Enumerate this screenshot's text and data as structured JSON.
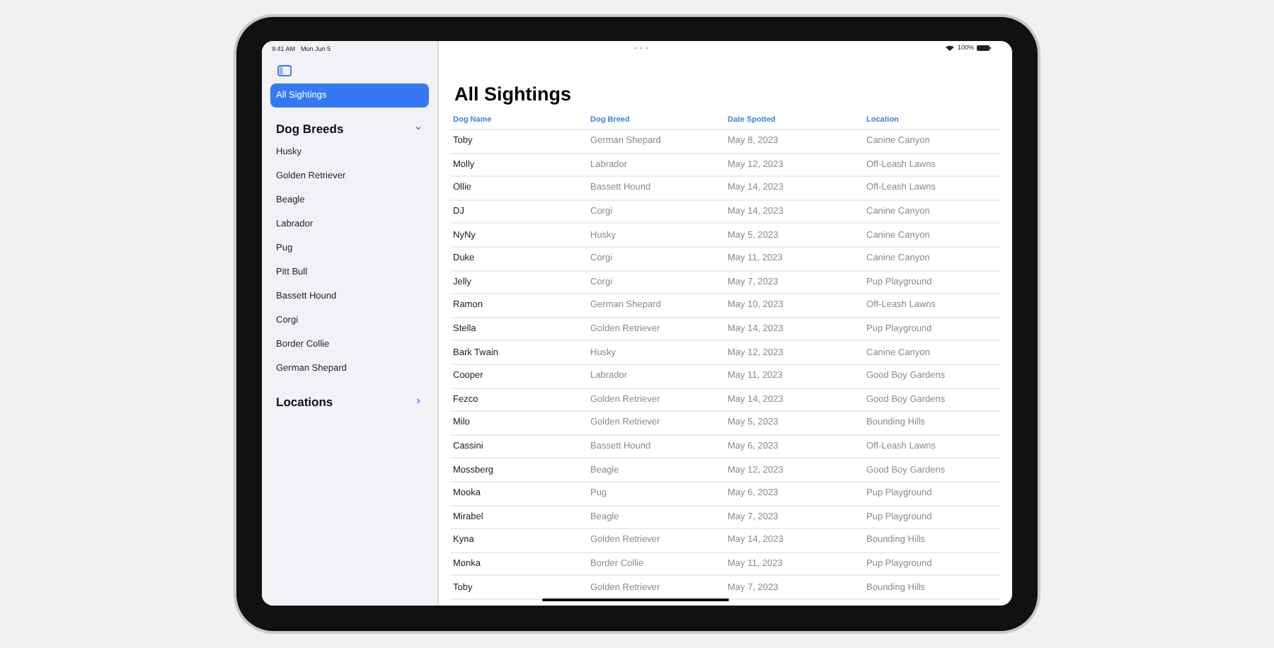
{
  "status_bar": {
    "time": "9:41 AM",
    "date": "Mon Jun 5",
    "battery": "100%"
  },
  "sidebar": {
    "items": [
      {
        "label": "All Sightings",
        "selected": true
      }
    ],
    "sections": [
      {
        "title": "Dog Breeds",
        "expanded": true,
        "children": [
          {
            "label": "Husky",
            "selected": false
          },
          {
            "label": "Golden Retriever",
            "selected": false
          },
          {
            "label": "Beagle",
            "selected": false
          },
          {
            "label": "Labrador",
            "selected": false
          },
          {
            "label": "Pug",
            "selected": false
          },
          {
            "label": "Pitt Bull",
            "selected": false
          },
          {
            "label": "Bassett Hound",
            "selected": false
          },
          {
            "label": "Corgi",
            "selected": false
          },
          {
            "label": "Border Collie",
            "selected": false
          },
          {
            "label": "German Shepard",
            "selected": false
          }
        ]
      },
      {
        "title": "Locations",
        "expanded": false
      }
    ]
  },
  "main": {
    "title": "All Sightings"
  },
  "table": {
    "columns": [
      "Dog Name",
      "Dog Breed",
      "Date Spotted",
      "Location"
    ],
    "rows": [
      [
        "Toby",
        "German Shepard",
        "May 8, 2023",
        "Canine Canyon"
      ],
      [
        "Molly",
        "Labrador",
        "May 12, 2023",
        "Off-Leash Lawns"
      ],
      [
        "Ollie",
        "Bassett Hound",
        "May 14, 2023",
        "Off-Leash Lawns"
      ],
      [
        "DJ",
        "Corgi",
        "May 14, 2023",
        "Canine Canyon"
      ],
      [
        "NyNy",
        "Husky",
        "May 5, 2023",
        "Canine Canyon"
      ],
      [
        "Duke",
        "Corgi",
        "May 11, 2023",
        "Canine Canyon"
      ],
      [
        "Jelly",
        "Corgi",
        "May 7, 2023",
        "Pup Playground"
      ],
      [
        "Ramon",
        "German Shepard",
        "May 10, 2023",
        "Off-Leash Lawns"
      ],
      [
        "Stella",
        "Golden Retriever",
        "May 14, 2023",
        "Pup Playground"
      ],
      [
        "Bark Twain",
        "Husky",
        "May 12, 2023",
        "Canine Canyon"
      ],
      [
        "Cooper",
        "Labrador",
        "May 11, 2023",
        "Good Boy Gardens"
      ],
      [
        "Fezco",
        "Golden Retriever",
        "May 14, 2023",
        "Good Boy Gardens"
      ],
      [
        "Milo",
        "Golden Retriever",
        "May 5, 2023",
        "Bounding Hills"
      ],
      [
        "Cassini",
        "Bassett Hound",
        "May 6, 2023",
        "Off-Leash Lawns"
      ],
      [
        "Mossberg",
        "Beagle",
        "May 12, 2023",
        "Good Boy Gardens"
      ],
      [
        "Mooka",
        "Pug",
        "May 6, 2023",
        "Pup Playground"
      ],
      [
        "Mirabel",
        "Beagle",
        "May 7, 2023",
        "Pup Playground"
      ],
      [
        "Kyna",
        "Golden Retriever",
        "May 14, 2023",
        "Bounding Hills"
      ],
      [
        "Monka",
        "Border Collie",
        "May 11, 2023",
        "Pup Playground"
      ],
      [
        "Toby",
        "Golden Retriever",
        "May 7, 2023",
        "Bounding Hills"
      ]
    ]
  }
}
